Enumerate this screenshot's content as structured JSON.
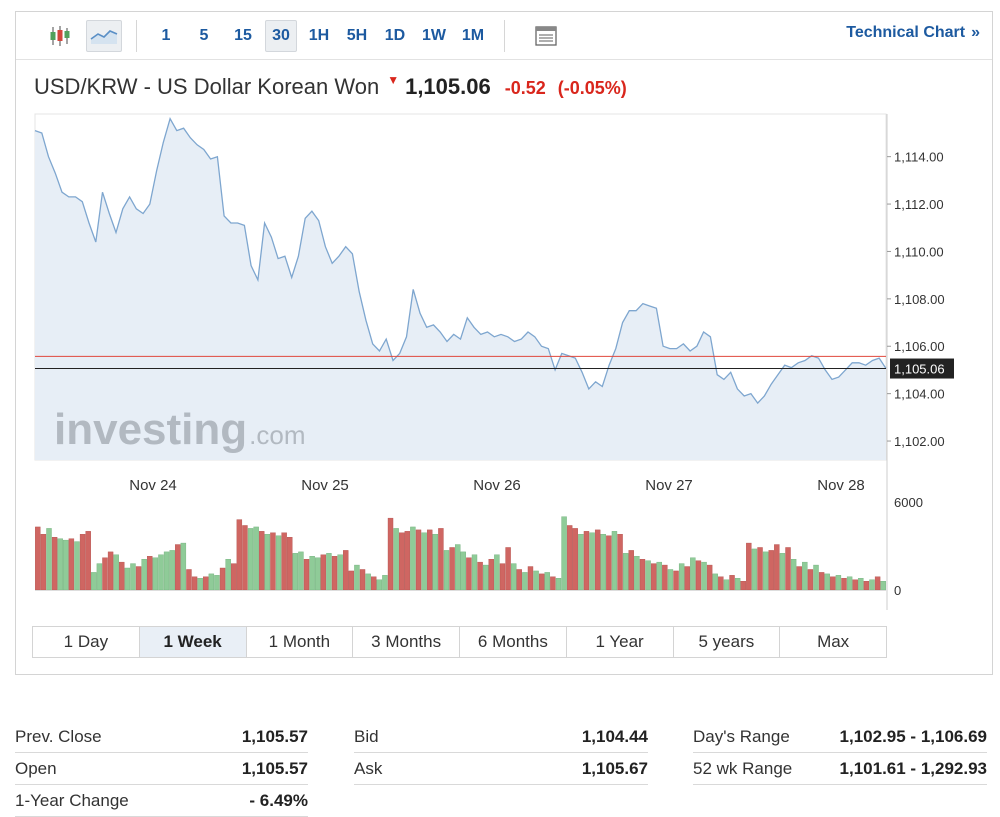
{
  "toolbar": {
    "intervals": [
      "1",
      "5",
      "15",
      "30",
      "1H",
      "5H",
      "1D",
      "1W",
      "1M"
    ],
    "active_interval": "30",
    "technical_chart_label": "Technical Chart",
    "technical_chart_arrows": "»"
  },
  "header": {
    "name": "USD/KRW - US Dollar Korean Won",
    "price": "1,105.06",
    "change": "-0.52",
    "change_pct": "(-0.05%)",
    "direction_icon": "down-triangle-icon"
  },
  "colors": {
    "line": "#7ea6cf",
    "area_fill": "#e7eef6",
    "prev_close_line": "#e0473c",
    "current_line": "#222222",
    "volume_up": "#8fcb98",
    "volume_down": "#cf6662",
    "link": "#1d5aa0",
    "negative": "#d9261c"
  },
  "chart_data": {
    "type": "line",
    "x_tick_labels": [
      "Nov 24",
      "Nov 25",
      "Nov 26",
      "Nov 27",
      "Nov 28"
    ],
    "y_tick_labels": [
      "1,114.00",
      "1,112.00",
      "1,110.00",
      "1,108.00",
      "1,106.00",
      "1,104.00",
      "1,102.00"
    ],
    "ylim": [
      1101.2,
      1115.8
    ],
    "current_label": "1,105.06",
    "current_value": 1105.06,
    "prev_close_value": 1105.57,
    "watermark": "investing",
    "watermark_suffix": ".com",
    "series": [
      {
        "values": [
          1115.1,
          1115.0,
          1114.0,
          1113.3,
          1112.5,
          1112.3,
          1112.3,
          1112.1,
          1111.2,
          1110.4,
          1112.5,
          1111.6,
          1110.8,
          1111.8,
          1112.3,
          1111.8,
          1111.6,
          1112.0,
          1113.4,
          1114.6,
          1115.6,
          1115.1,
          1115.2,
          1114.8,
          1114.5,
          1114.3,
          1113.9,
          1114.0,
          1111.5,
          1111.2,
          1111.2,
          1111.1,
          1109.4,
          1108.8,
          1111.2,
          1110.6,
          1109.7,
          1109.8,
          1108.9,
          1109.8,
          1111.4,
          1111.7,
          1111.3,
          1110.2,
          1109.5,
          1109.8,
          1110.2,
          1109.9,
          1108.3,
          1107.1,
          1106.1,
          1105.8,
          1106.3,
          1105.4,
          1105.7,
          1106.4,
          1108.4,
          1107.4,
          1106.8,
          1106.9,
          1106.6,
          1106.2,
          1106.5,
          1106.3,
          1107.2,
          1106.8,
          1106.5,
          1106.6,
          1106.4,
          1106.5,
          1106.4,
          1106.2,
          1106.3,
          1106.6,
          1106.4,
          1106.0,
          1105.9,
          1105.0,
          1105.7,
          1105.6,
          1105.5,
          1104.9,
          1104.2,
          1104.5,
          1104.3,
          1105.2,
          1105.9,
          1107.0,
          1107.5,
          1107.5,
          1107.8,
          1107.7,
          1107.6,
          1106.0,
          1105.9,
          1105.9,
          1106.1,
          1105.8,
          1106.0,
          1106.6,
          1106.4,
          1104.8,
          1104.6,
          1104.9,
          1104.2,
          1103.9,
          1104.0,
          1103.6,
          1103.9,
          1104.4,
          1104.8,
          1105.2,
          1105.1,
          1105.3,
          1105.4,
          1105.6,
          1105.5,
          1105.0,
          1104.6,
          1104.7,
          1105.0,
          1105.3,
          1105.3,
          1105.2,
          1105.4,
          1105.5,
          1105.06
        ]
      }
    ],
    "volume": {
      "axis_labels": [
        "6000",
        "0"
      ],
      "max": 6000,
      "bars": [
        [
          4300,
          "d"
        ],
        [
          3800,
          "d"
        ],
        [
          4200,
          "u"
        ],
        [
          3600,
          "d"
        ],
        [
          3500,
          "u"
        ],
        [
          3400,
          "u"
        ],
        [
          3500,
          "d"
        ],
        [
          3300,
          "u"
        ],
        [
          3800,
          "d"
        ],
        [
          4000,
          "d"
        ],
        [
          1200,
          "u"
        ],
        [
          1800,
          "u"
        ],
        [
          2200,
          "d"
        ],
        [
          2600,
          "d"
        ],
        [
          2400,
          "u"
        ],
        [
          1900,
          "d"
        ],
        [
          1500,
          "u"
        ],
        [
          1800,
          "u"
        ],
        [
          1600,
          "d"
        ],
        [
          2100,
          "u"
        ],
        [
          2300,
          "d"
        ],
        [
          2200,
          "u"
        ],
        [
          2400,
          "u"
        ],
        [
          2600,
          "u"
        ],
        [
          2700,
          "u"
        ],
        [
          3100,
          "d"
        ],
        [
          3200,
          "u"
        ],
        [
          1400,
          "d"
        ],
        [
          900,
          "d"
        ],
        [
          800,
          "u"
        ],
        [
          900,
          "d"
        ],
        [
          1100,
          "u"
        ],
        [
          1000,
          "u"
        ],
        [
          1500,
          "d"
        ],
        [
          2100,
          "u"
        ],
        [
          1800,
          "d"
        ],
        [
          4800,
          "d"
        ],
        [
          4400,
          "d"
        ],
        [
          4200,
          "u"
        ],
        [
          4300,
          "u"
        ],
        [
          4000,
          "d"
        ],
        [
          3800,
          "u"
        ],
        [
          3900,
          "d"
        ],
        [
          3700,
          "u"
        ],
        [
          3900,
          "d"
        ],
        [
          3600,
          "d"
        ],
        [
          2500,
          "u"
        ],
        [
          2600,
          "u"
        ],
        [
          2100,
          "d"
        ],
        [
          2300,
          "u"
        ],
        [
          2200,
          "u"
        ],
        [
          2400,
          "d"
        ],
        [
          2500,
          "u"
        ],
        [
          2300,
          "d"
        ],
        [
          2400,
          "u"
        ],
        [
          2700,
          "d"
        ],
        [
          1300,
          "d"
        ],
        [
          1700,
          "u"
        ],
        [
          1400,
          "d"
        ],
        [
          1100,
          "u"
        ],
        [
          900,
          "d"
        ],
        [
          700,
          "u"
        ],
        [
          1000,
          "u"
        ],
        [
          4900,
          "d"
        ],
        [
          4200,
          "u"
        ],
        [
          3900,
          "d"
        ],
        [
          4000,
          "d"
        ],
        [
          4300,
          "u"
        ],
        [
          4100,
          "d"
        ],
        [
          3900,
          "u"
        ],
        [
          4100,
          "d"
        ],
        [
          3800,
          "u"
        ],
        [
          4200,
          "d"
        ],
        [
          2700,
          "u"
        ],
        [
          2900,
          "d"
        ],
        [
          3100,
          "u"
        ],
        [
          2600,
          "u"
        ],
        [
          2200,
          "d"
        ],
        [
          2400,
          "u"
        ],
        [
          1900,
          "d"
        ],
        [
          1700,
          "u"
        ],
        [
          2100,
          "d"
        ],
        [
          2400,
          "u"
        ],
        [
          1800,
          "d"
        ],
        [
          2900,
          "d"
        ],
        [
          1800,
          "u"
        ],
        [
          1400,
          "d"
        ],
        [
          1200,
          "u"
        ],
        [
          1600,
          "d"
        ],
        [
          1300,
          "u"
        ],
        [
          1100,
          "d"
        ],
        [
          1200,
          "u"
        ],
        [
          900,
          "d"
        ],
        [
          800,
          "u"
        ],
        [
          5000,
          "u"
        ],
        [
          4400,
          "d"
        ],
        [
          4200,
          "d"
        ],
        [
          3800,
          "u"
        ],
        [
          4000,
          "d"
        ],
        [
          3900,
          "u"
        ],
        [
          4100,
          "d"
        ],
        [
          3800,
          "u"
        ],
        [
          3700,
          "d"
        ],
        [
          4000,
          "u"
        ],
        [
          3800,
          "d"
        ],
        [
          2500,
          "u"
        ],
        [
          2700,
          "d"
        ],
        [
          2300,
          "u"
        ],
        [
          2100,
          "d"
        ],
        [
          2000,
          "u"
        ],
        [
          1800,
          "d"
        ],
        [
          1900,
          "u"
        ],
        [
          1700,
          "d"
        ],
        [
          1400,
          "u"
        ],
        [
          1300,
          "d"
        ],
        [
          1800,
          "u"
        ],
        [
          1600,
          "d"
        ],
        [
          2200,
          "u"
        ],
        [
          2000,
          "d"
        ],
        [
          1900,
          "u"
        ],
        [
          1700,
          "d"
        ],
        [
          1100,
          "u"
        ],
        [
          900,
          "d"
        ],
        [
          700,
          "u"
        ],
        [
          1000,
          "d"
        ],
        [
          800,
          "u"
        ],
        [
          600,
          "d"
        ],
        [
          3200,
          "d"
        ],
        [
          2800,
          "u"
        ],
        [
          2900,
          "d"
        ],
        [
          2600,
          "u"
        ],
        [
          2700,
          "d"
        ],
        [
          3100,
          "d"
        ],
        [
          2500,
          "u"
        ],
        [
          2900,
          "d"
        ],
        [
          2100,
          "u"
        ],
        [
          1600,
          "d"
        ],
        [
          1900,
          "u"
        ],
        [
          1400,
          "d"
        ],
        [
          1700,
          "u"
        ],
        [
          1200,
          "d"
        ],
        [
          1100,
          "u"
        ],
        [
          900,
          "d"
        ],
        [
          1000,
          "u"
        ],
        [
          800,
          "d"
        ],
        [
          900,
          "u"
        ],
        [
          700,
          "d"
        ],
        [
          800,
          "u"
        ],
        [
          600,
          "d"
        ],
        [
          700,
          "u"
        ],
        [
          900,
          "d"
        ],
        [
          600,
          "u"
        ]
      ]
    }
  },
  "ranges": [
    "1 Day",
    "1 Week",
    "1 Month",
    "3 Months",
    "6 Months",
    "1 Year",
    "5 years",
    "Max"
  ],
  "active_range": "1 Week",
  "stats": {
    "col1": [
      {
        "label": "Prev. Close",
        "value": "1,105.57"
      },
      {
        "label": "Open",
        "value": "1,105.57"
      },
      {
        "label": "1-Year Change",
        "value": "- 6.49%"
      }
    ],
    "col2": [
      {
        "label": "Bid",
        "value": "1,104.44"
      },
      {
        "label": "Ask",
        "value": "1,105.67"
      }
    ],
    "col3": [
      {
        "label": "Day's Range",
        "value": "1,102.95 - 1,106.69"
      },
      {
        "label": "52 wk Range",
        "value": "1,101.61 - 1,292.93"
      }
    ]
  }
}
